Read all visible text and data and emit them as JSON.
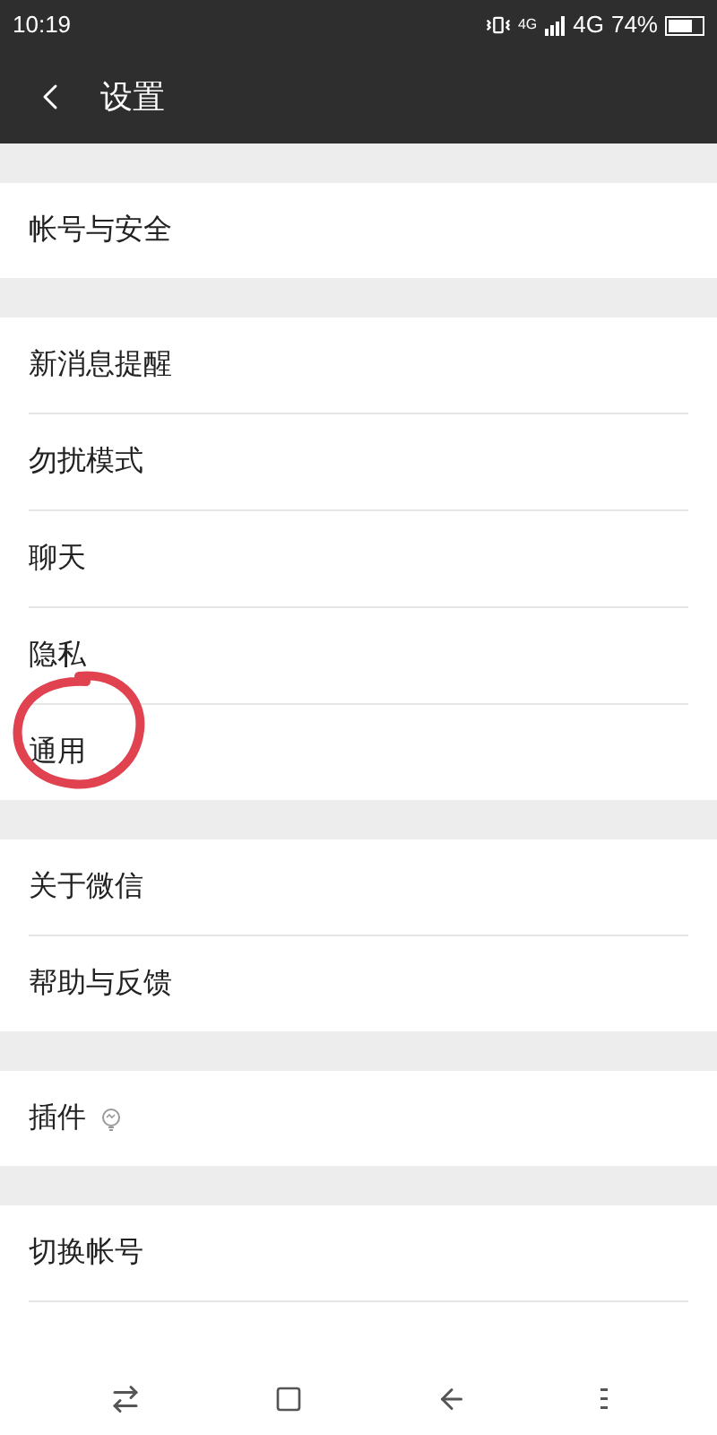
{
  "status_bar": {
    "time": "10:19",
    "data_label": "4G",
    "network": "4G",
    "battery": "74%"
  },
  "header": {
    "title": "设置"
  },
  "sections": [
    {
      "items": [
        {
          "label": "帐号与安全",
          "kind": "plain",
          "highlighted": false
        }
      ]
    },
    {
      "items": [
        {
          "label": "新消息提醒",
          "kind": "plain",
          "highlighted": false
        },
        {
          "label": "勿扰模式",
          "kind": "plain",
          "highlighted": false
        },
        {
          "label": "聊天",
          "kind": "plain",
          "highlighted": false
        },
        {
          "label": "隐私",
          "kind": "plain",
          "highlighted": false
        },
        {
          "label": "通用",
          "kind": "plain",
          "highlighted": true
        }
      ]
    },
    {
      "items": [
        {
          "label": "关于微信",
          "kind": "plain",
          "highlighted": false
        },
        {
          "label": "帮助与反馈",
          "kind": "plain",
          "highlighted": false
        }
      ]
    },
    {
      "items": [
        {
          "label": "插件",
          "kind": "with-icon",
          "highlighted": false
        }
      ]
    },
    {
      "items": [
        {
          "label": "切换帐号",
          "kind": "plain",
          "highlighted": false
        },
        {
          "kind": "cut",
          "highlighted": false
        }
      ]
    }
  ]
}
